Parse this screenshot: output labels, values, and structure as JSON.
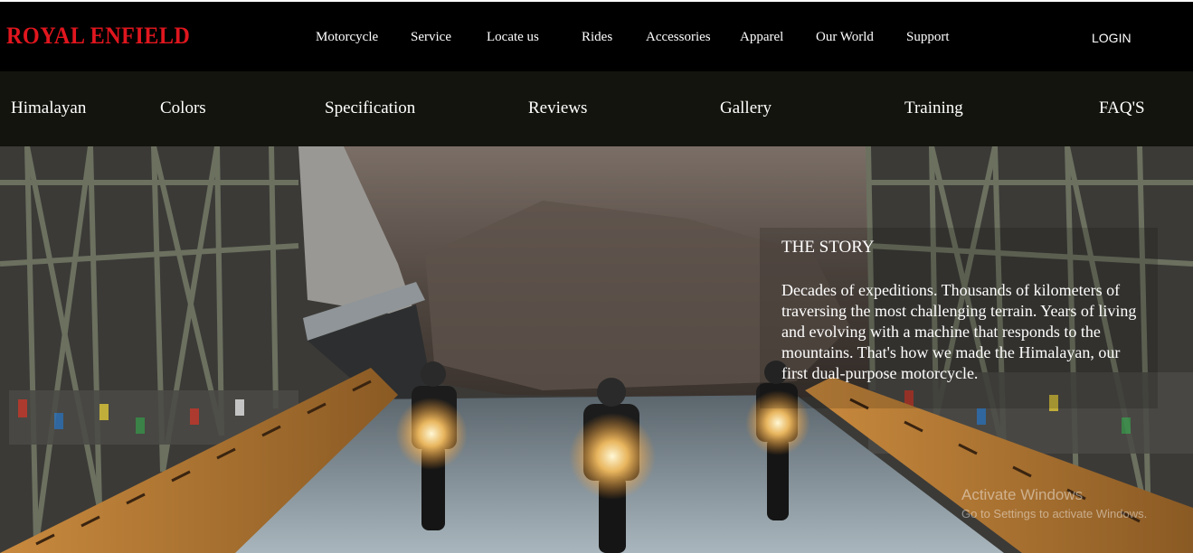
{
  "brand": {
    "logo_text": "ROYAL ENFIELD",
    "color": "#e0161e"
  },
  "topnav": {
    "items": [
      "Motorcycle",
      "Service",
      "Locate us",
      "Rides",
      "Accessories",
      "Apparel",
      "Our World",
      "Support"
    ],
    "login": "LOGIN"
  },
  "subnav": {
    "items": [
      "Himalayan",
      "Colors",
      "Specification",
      "Reviews",
      "Gallery",
      "Training",
      "FAQ'S"
    ]
  },
  "story": {
    "title": "THE STORY",
    "text": "Decades of expeditions. Thousands of kilometers of traversing the most challenging terrain. Years of living and evolving with a machine that responds to the mountains. That's how we made the Himalayan, our first dual-purpose motorcycle."
  },
  "watermark": {
    "title": "Activate Windows",
    "subtitle": "Go to Settings to activate Windows."
  }
}
